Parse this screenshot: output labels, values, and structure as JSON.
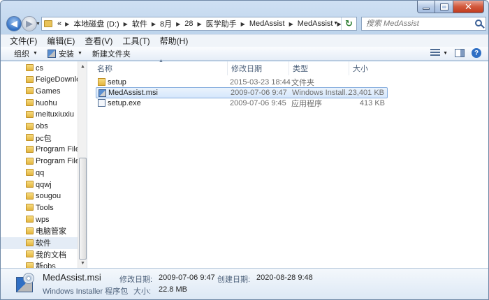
{
  "window": {
    "caption": {
      "min": "",
      "max": "",
      "close": "✕"
    }
  },
  "nav": {
    "back_glyph": "◀",
    "forward_glyph": "▶"
  },
  "address": {
    "overflow": "«",
    "crumbs": [
      "本地磁盘 (D:)",
      "软件",
      "8月",
      "28",
      "医学助手",
      "MedAssist",
      "MedAssist"
    ],
    "refresh_glyph": "↻"
  },
  "search": {
    "placeholder": "搜索 MedAssist"
  },
  "menu": [
    "文件(F)",
    "编辑(E)",
    "查看(V)",
    "工具(T)",
    "帮助(H)"
  ],
  "toolbar": {
    "organize": "组织",
    "install": "安装",
    "new_folder": "新建文件夹",
    "help": "?"
  },
  "sidebar": {
    "items": [
      {
        "label": "cs"
      },
      {
        "label": "FeigeDownload"
      },
      {
        "label": "Games"
      },
      {
        "label": "huohu"
      },
      {
        "label": "meituxiuxiu"
      },
      {
        "label": "obs"
      },
      {
        "label": "pc包"
      },
      {
        "label": "Program Files"
      },
      {
        "label": "Program Files"
      },
      {
        "label": "qq"
      },
      {
        "label": "qqwj"
      },
      {
        "label": "sougou"
      },
      {
        "label": "Tools"
      },
      {
        "label": "wps"
      },
      {
        "label": "电脑管家"
      },
      {
        "label": "软件",
        "selected": true
      },
      {
        "label": "我的文档"
      },
      {
        "label": "新obs"
      }
    ]
  },
  "columns": {
    "name": "名称",
    "date": "修改日期",
    "type": "类型",
    "size": "大小"
  },
  "files": [
    {
      "name": "setup",
      "date": "2015-03-23 18:44",
      "type": "文件夹",
      "size": "",
      "icon": "folder-icon"
    },
    {
      "name": "MedAssist.msi",
      "date": "2009-07-06 9:47",
      "type": "Windows Install...",
      "size": "23,401 KB",
      "icon": "msi-icon",
      "selected": true
    },
    {
      "name": "setup.exe",
      "date": "2009-07-06 9:45",
      "type": "应用程序",
      "size": "413 KB",
      "icon": "exe-icon"
    }
  ],
  "details": {
    "name": "MedAssist.msi",
    "type": "Windows Installer 程序包",
    "modified_label": "修改日期:",
    "modified_value": "2009-07-06 9:47",
    "created_label": "创建日期:",
    "created_value": "2020-08-28 9:48",
    "size_label": "大小:",
    "size_value": "22.8 MB"
  }
}
